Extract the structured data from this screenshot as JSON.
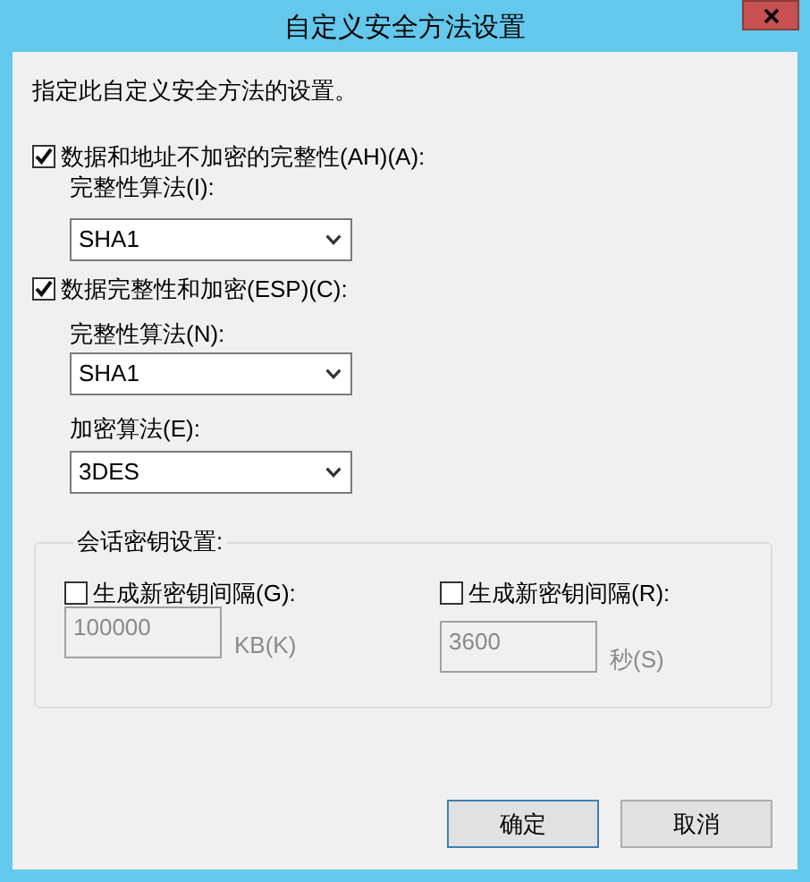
{
  "window": {
    "title": "自定义安全方法设置"
  },
  "description": "指定此自定义安全方法的设置。",
  "ah": {
    "label": "数据和地址不加密的完整性(AH)(A):",
    "checked": true,
    "integrity_label": "完整性算法(I):",
    "integrity_value": "SHA1"
  },
  "esp": {
    "label": "数据完整性和加密(ESP)(C):",
    "checked": true,
    "integrity_label": "完整性算法(N):",
    "integrity_value": "SHA1",
    "encryption_label": "加密算法(E):",
    "encryption_value": "3DES"
  },
  "session_keys": {
    "title": "会话密钥设置:",
    "intervals": [
      {
        "label": "生成新密钥间隔(G):",
        "checked": false,
        "value": "100000",
        "disabled": true,
        "unit": "KB(K)"
      },
      {
        "label": "生成新密钥间隔(R):",
        "checked": false,
        "value": "3600",
        "disabled": true,
        "unit": "秒(S)"
      }
    ]
  },
  "buttons": [
    {
      "label": "确定",
      "default": true
    },
    {
      "label": "取消",
      "default": false
    }
  ]
}
